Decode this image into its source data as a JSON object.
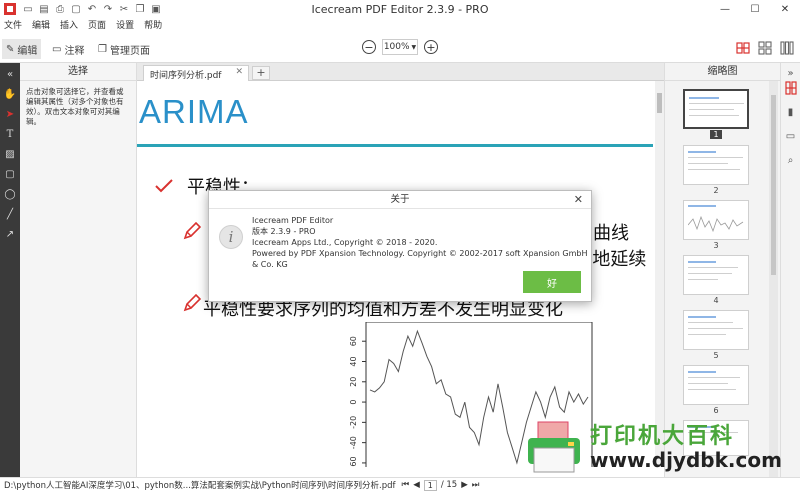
{
  "window": {
    "title": "Icecream PDF Editor 2.3.9 - PRO"
  },
  "menu": [
    "文件",
    "编辑",
    "插入",
    "页面",
    "设置",
    "帮助"
  ],
  "toolbar": {
    "edit_label": "编辑",
    "annotate_label": "注释",
    "manage_label": "管理页面",
    "zoom_value": "100%"
  },
  "select_panel": {
    "title": "选择",
    "help": "点击对象可选择它，并查看或编辑其属性（对多个对象也有效）。双击文本对象可对其编辑。"
  },
  "doc_tab": {
    "name": "时间序列分析.pdf"
  },
  "document": {
    "heading": "ARIMA",
    "bullet1": "平稳性：",
    "frag_right1": "曲线",
    "frag_right2": "”地延续",
    "bullet3": "平稳性要求序列的均值和方差不发生明显变化",
    "chart_ticks": [
      "60",
      "40",
      "20",
      "0",
      "-20",
      "-40",
      "-60"
    ]
  },
  "chart_data": {
    "type": "line",
    "title": "",
    "xlabel": "",
    "ylabel": "",
    "ylim": [
      -65,
      75
    ],
    "y_ticks": [
      60,
      40,
      20,
      0,
      -20,
      -40,
      -60
    ],
    "values": [
      12,
      10,
      14,
      20,
      42,
      38,
      30,
      50,
      65,
      55,
      70,
      58,
      45,
      35,
      18,
      22,
      8,
      5,
      -12,
      -15,
      0,
      -25,
      -30,
      -42,
      -15,
      5,
      -10,
      18,
      -5,
      -30,
      -45,
      -60,
      -40,
      -20,
      -5,
      10,
      0,
      -15,
      5,
      15,
      -5,
      -10,
      10,
      0,
      8,
      -2,
      5
    ]
  },
  "thumbnails": {
    "title": "缩略图",
    "pages": [
      "1",
      "2",
      "3",
      "4",
      "5",
      "6"
    ]
  },
  "about": {
    "title": "关于",
    "line1": "Icecream PDF Editor",
    "line2": "版本 2.3.9 - PRO",
    "line3": "Icecream Apps Ltd., Copyright © 2018 - 2020.",
    "line4": "Powered by PDF Xpansion Technology. Copyright © 2002-2017 soft Xpansion GmbH & Co. KG",
    "ok_label": "好"
  },
  "status": {
    "path": "D:\\python人工智能AI深度学习\\01、python数...算法配套案例实战\\Python时间序列\\时间序列分析.pdf",
    "page_current": "1",
    "page_total": "/ 15"
  },
  "watermark": {
    "line1": "打印机大百科",
    "line2": "www.djydbk.com"
  },
  "colors": {
    "accent_red": "#d9322f",
    "doc_heading": "#2a90c9",
    "ok_green": "#6cbd45",
    "rail_dark": "#3a3a3a"
  }
}
